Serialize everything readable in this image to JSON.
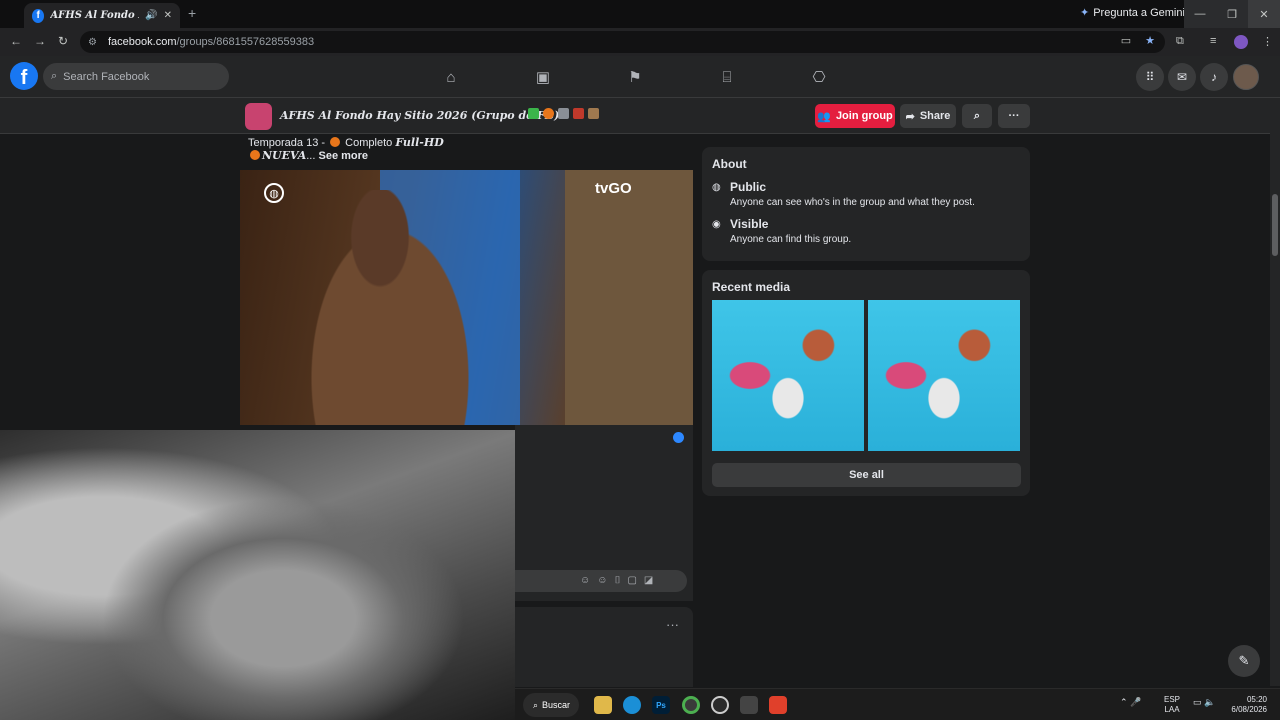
{
  "browser": {
    "tab_title": "AFHS Al Fondo Hay Sitio",
    "gemini_label": "Pregunta a Gemini",
    "url_host": "facebook.com",
    "url_path": "/groups/8681557628559383"
  },
  "facebook": {
    "search_placeholder": "Search Facebook",
    "logo_letter": "f"
  },
  "group": {
    "name": "AFHS Al Fondo Hay Sitio 2026 (Grupo de FB)",
    "join_label": "Join group",
    "share_label": "Share"
  },
  "post": {
    "line1_prefix": "Temporada 13 - ",
    "line1_suffix": " Completo ",
    "line1_bold": "Full-HD",
    "line2_bold": "NUEVA",
    "line2_rest": "... ",
    "see_more": "See more",
    "video_logo": "tvGO"
  },
  "about": {
    "title": "About",
    "rows": [
      {
        "title": "Public",
        "desc": "Anyone can see who's in the group and what they post."
      },
      {
        "title": "Visible",
        "desc": "Anyone can find this group."
      }
    ]
  },
  "media": {
    "title": "Recent media",
    "see_all": "See all"
  },
  "taskbar": {
    "search_label": "Buscar",
    "lang_1": "ESP",
    "lang_2": "LAA",
    "time": "05:20",
    "date": "6/08/2026"
  }
}
